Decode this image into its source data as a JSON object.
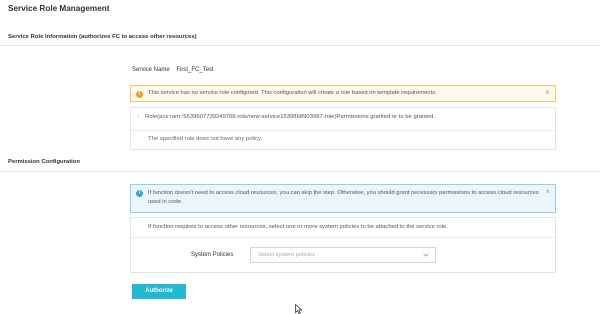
{
  "page": {
    "title": "Service Role Management"
  },
  "role_info": {
    "heading": "Service Role Information (authorizes FC to access other resources)",
    "service_name_label": "Service Name",
    "service_name_value": "First_FC_Test",
    "warning": "This service has no service role configured. This configuration will create a role based on template requirements.",
    "role_line": "Role(acs:ram::5639607739249766:role/new-service1539868903987-role)Permissions granted or to be granted.",
    "no_policy": "The specified role does not have any policy."
  },
  "permission": {
    "heading": "Permission Configuration",
    "info": "If function doesn't need to access cloud resources, you can skip the step. Otherwise, you should grant necessary permissions to access cloud resources used in code.",
    "note": "If function requires to access other resources, select one or more system policies to be attached to the service role.",
    "policies_label": "System Policies",
    "policies_placeholder": "Select system policies"
  },
  "actions": {
    "authorize_label": "Authorize"
  },
  "icons": {
    "warning": "exclamation-circle-icon",
    "info": "info-circle-icon",
    "close": "close-icon",
    "expand": "chevron-right-icon",
    "dropdown": "chevron-down-icon",
    "cursor": "mouse-pointer-icon"
  },
  "colors": {
    "primary_button": "#21b8d4",
    "warning_bg": "#fff9ec",
    "warning_border": "#f6c66a",
    "info_bg": "#eaf6fb",
    "info_border": "#8ed1ea"
  }
}
